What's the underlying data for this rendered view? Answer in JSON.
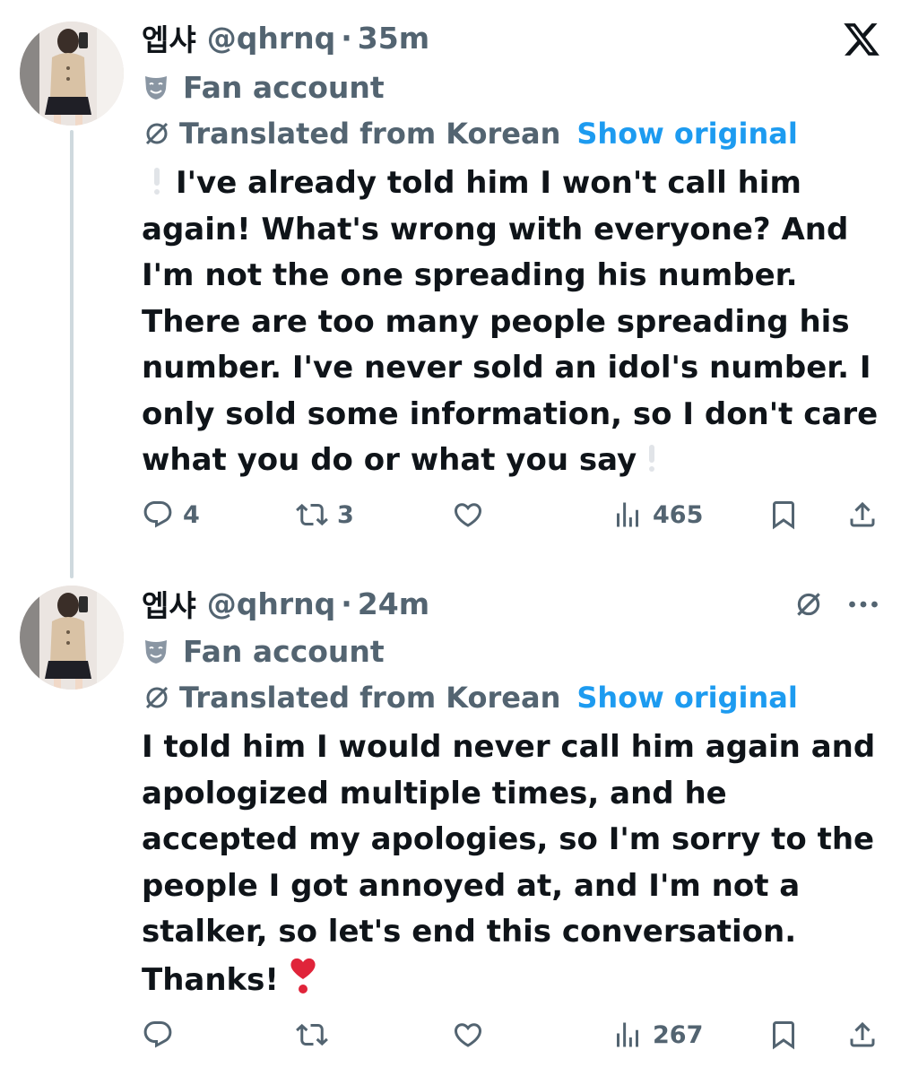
{
  "app": {
    "logo": "x-logo-icon"
  },
  "tweets": [
    {
      "display_name": "엡샤",
      "handle": "@qhrnq",
      "separator": "·",
      "time": "35m",
      "label": "Fan account",
      "translated_label": "Translated from Korean",
      "show_original": "Show original",
      "lines": [
        "I've already told him I won't call him",
        "again! What's wrong with everyone? And",
        "I'm not the one spreading his number.",
        "There are too many people spreading his",
        "number. I've never sold an idol's number. I",
        "only sold some information, so I don't care",
        "what you do or what you say"
      ],
      "replies": "4",
      "reposts": "3",
      "likes": "",
      "views": "465"
    },
    {
      "display_name": "엡샤",
      "handle": "@qhrnq",
      "separator": "·",
      "time": "24m",
      "label": "Fan account",
      "translated_label": "Translated from Korean",
      "show_original": "Show original",
      "lines": [
        "I told him I would never call him again and",
        "apologized multiple times, and he",
        "accepted my apologies, so I'm sorry to the",
        "people I got annoyed at, and I'm not a",
        "stalker, so let's end this conversation.",
        "Thanks!"
      ],
      "replies": "",
      "reposts": "",
      "likes": "",
      "views": "267"
    }
  ],
  "colors": {
    "text": "#0f1419",
    "secondary": "#536471",
    "link": "#1d9bf0",
    "thread": "#cfd9de",
    "heart_emoji": "#e0243a"
  }
}
